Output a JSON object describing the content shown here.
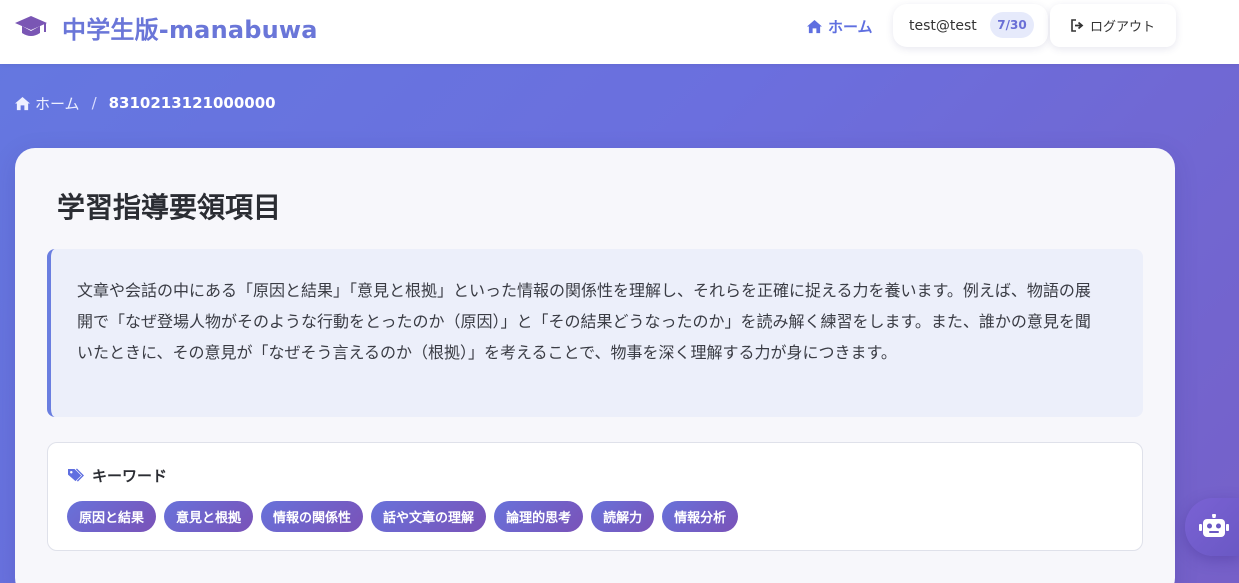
{
  "header": {
    "brand_icon": "graduation-cap-icon",
    "brand_title": "中学生版-manabuwa",
    "nav_home_label": "ホーム",
    "user_email": "test@test",
    "usage_count": "7/30",
    "logout_label": "ログアウト"
  },
  "breadcrumb": {
    "home_label": "ホーム",
    "separator": "/",
    "current": "8310213121000000"
  },
  "main": {
    "title": "学習指導要領項目",
    "description": "文章や会話の中にある「原因と結果」「意見と根拠」といった情報の関係性を理解し、それらを正確に捉える力を養います。例えば、物語の展開で「なぜ登場人物がそのような行動をとったのか（原因）」と「その結果どうなったのか」を読み解く練習をします。また、誰かの意見を聞いたときに、その意見が「なぜそう言えるのか（根拠）」を考えることで、物事を深く理解する力が身につきます。",
    "keywords": {
      "heading": "キーワード",
      "icon": "tags-icon",
      "tags": [
        "原因と結果",
        "意見と根拠",
        "情報の関係性",
        "話や文章の理解",
        "論理的思考",
        "読解力",
        "情報分析"
      ]
    }
  },
  "assistant_button": {
    "icon": "robot-icon"
  },
  "colors": {
    "brand": "#6a76d8",
    "accent": "#5f6fe0",
    "background_gradient_start": "#6478e0",
    "background_gradient_end": "#7660c8",
    "tag_gradient_start": "#6872da",
    "tag_gradient_end": "#7a52b8"
  }
}
